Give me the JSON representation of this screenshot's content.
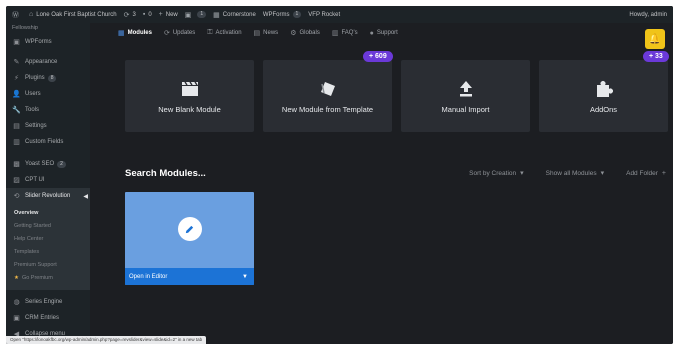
{
  "adminbar": {
    "site_name": "Lone Oak First Baptist Church",
    "updates_count": "3",
    "comments_count": "0",
    "new_label": "New",
    "cornerstone_label": "Cornerstone",
    "wpforms_label": "WPForms",
    "wpforms_count": "1",
    "vfp_label": "VFP Rocket",
    "greeting": "Howdy, admin"
  },
  "sidebar": {
    "top_partial": "Fellowship",
    "items": [
      {
        "label": "WPForms",
        "icon": "wpforms-icon"
      },
      {
        "label": "Appearance",
        "icon": "brush-icon"
      },
      {
        "label": "Plugins",
        "icon": "plug-icon",
        "badge": "8"
      },
      {
        "label": "Users",
        "icon": "user-icon"
      },
      {
        "label": "Tools",
        "icon": "wrench-icon"
      },
      {
        "label": "Settings",
        "icon": "settings-icon"
      },
      {
        "label": "Custom Fields",
        "icon": "fields-icon"
      },
      {
        "label": "Yoast SEO",
        "icon": "yoast-icon",
        "badge": "2"
      },
      {
        "label": "CPT UI",
        "icon": "cpt-icon"
      },
      {
        "label": "Slider Revolution",
        "icon": "slider-icon"
      }
    ],
    "submenu": [
      {
        "label": "Overview"
      },
      {
        "label": "Getting Started"
      },
      {
        "label": "Help Center"
      },
      {
        "label": "Templates"
      },
      {
        "label": "Premium Support"
      },
      {
        "label": "Go Premium"
      }
    ],
    "bottom_items": [
      {
        "label": "Series Engine",
        "icon": "series-icon"
      },
      {
        "label": "CRM Entries",
        "icon": "crm-icon"
      },
      {
        "label": "Collapse menu",
        "icon": "collapse-icon"
      }
    ]
  },
  "modnav": {
    "items": [
      {
        "label": "Modules",
        "icon": "modules-icon"
      },
      {
        "label": "Updates",
        "icon": "updates-icon"
      },
      {
        "label": "Activation",
        "icon": "activation-icon"
      },
      {
        "label": "News",
        "icon": "news-icon"
      },
      {
        "label": "Globals",
        "icon": "globals-icon"
      },
      {
        "label": "FAQ's",
        "icon": "faq-icon"
      },
      {
        "label": "Support",
        "icon": "support-icon"
      }
    ]
  },
  "cards": [
    {
      "label": "New Blank Module",
      "icon": "clapper-icon"
    },
    {
      "label": "New Module from Template",
      "icon": "template-icon",
      "badge": "+ 609"
    },
    {
      "label": "Manual Import",
      "icon": "import-icon"
    },
    {
      "label": "AddOns",
      "icon": "puzzle-icon",
      "badge": "+ 33"
    }
  ],
  "search": {
    "title": "Search Modules..."
  },
  "toolbar": {
    "sort_label": "Sort by Creation",
    "show_label": "Show all Modules",
    "add_folder_label": "Add Folder"
  },
  "tile": {
    "footer_label": "Open in Editor"
  },
  "statusbar": {
    "text": "Open \"https://lonoakfbc.org/wp-admin/admin.php?page=revslider&view=slide&id=2\" in a new tab"
  },
  "colors": {
    "accent_blue": "#1c73d6",
    "tile_blue": "#6a9fe0",
    "badge_purple": "#6b39d8",
    "bell_yellow": "#f0c419"
  }
}
